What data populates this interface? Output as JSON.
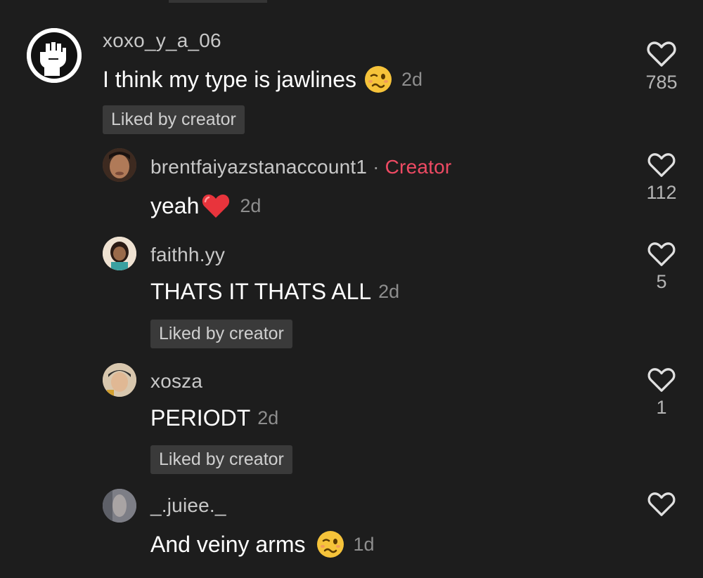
{
  "comments": [
    {
      "username": "xoxo_y_a_06",
      "text": "I think my type is jawlines",
      "emoji": "woozy-face",
      "time": "2d",
      "liked_badge": "Liked by creator",
      "likes": "785",
      "avatar": "raised-fist-avatar"
    },
    {
      "username": "brentfaiyazstanaccount1",
      "separator": "·",
      "creator_label": "Creator",
      "text": "yeah",
      "emoji": "red-heart",
      "time": "2d",
      "likes": "112",
      "avatar": "photo-avatar"
    },
    {
      "username": "faithh.yy",
      "text": "THATS IT THATS ALL",
      "time": "2d",
      "liked_badge": "Liked by creator",
      "likes": "5",
      "avatar": "cartoon-girl-avatar"
    },
    {
      "username": "xosza",
      "text": "PERIODT",
      "time": "2d",
      "liked_badge": "Liked by creator",
      "likes": "1",
      "avatar": "photo-avatar"
    },
    {
      "username": "_.juiee._",
      "text": "And veiny arms",
      "emoji": "woozy-face",
      "time": "1d",
      "likes": "",
      "avatar": "photo-avatar"
    }
  ],
  "colors": {
    "background": "#1d1d1d",
    "creator_accent": "#ee4a63",
    "badge_bg": "#3a3a3a"
  }
}
